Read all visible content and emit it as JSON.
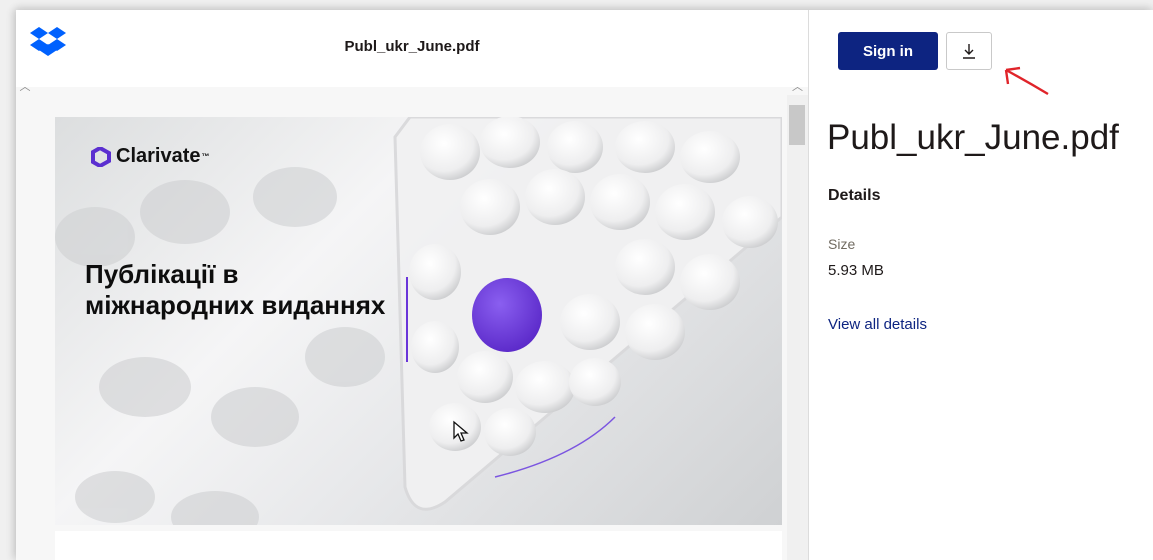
{
  "viewer": {
    "file_title": "Publ_ukr_June.pdf",
    "page": {
      "brand": "Clarivate",
      "brand_tm": "™",
      "headline_line1": "Публікації в",
      "headline_line2": "міжнародних виданнях"
    }
  },
  "sidebar": {
    "signin_label": "Sign in",
    "title": "Publ_ukr_June.pdf",
    "details_heading": "Details",
    "size_label": "Size",
    "size_value": "5.93 MB",
    "view_all_label": "View all details"
  },
  "colors": {
    "brand_blue": "#0d2481",
    "dropbox_blue": "#0061fe",
    "accent_purple": "#6a35d9",
    "annotation_red": "#e0242a"
  },
  "icons": [
    "dropbox-logo-icon",
    "download-icon",
    "clarivate-logo-icon",
    "cursor-icon",
    "annotation-arrow-icon"
  ]
}
